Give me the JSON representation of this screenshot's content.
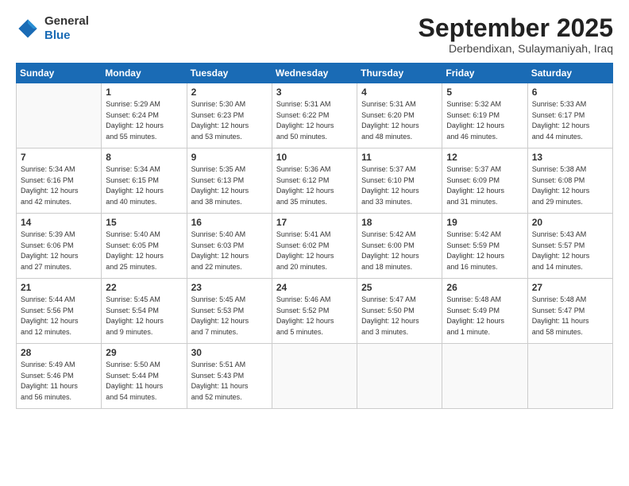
{
  "header": {
    "logo_line1": "General",
    "logo_line2": "Blue",
    "month": "September 2025",
    "location": "Derbendixan, Sulaymaniyah, Iraq"
  },
  "weekdays": [
    "Sunday",
    "Monday",
    "Tuesday",
    "Wednesday",
    "Thursday",
    "Friday",
    "Saturday"
  ],
  "weeks": [
    [
      {
        "num": "",
        "info": ""
      },
      {
        "num": "1",
        "info": "Sunrise: 5:29 AM\nSunset: 6:24 PM\nDaylight: 12 hours\nand 55 minutes."
      },
      {
        "num": "2",
        "info": "Sunrise: 5:30 AM\nSunset: 6:23 PM\nDaylight: 12 hours\nand 53 minutes."
      },
      {
        "num": "3",
        "info": "Sunrise: 5:31 AM\nSunset: 6:22 PM\nDaylight: 12 hours\nand 50 minutes."
      },
      {
        "num": "4",
        "info": "Sunrise: 5:31 AM\nSunset: 6:20 PM\nDaylight: 12 hours\nand 48 minutes."
      },
      {
        "num": "5",
        "info": "Sunrise: 5:32 AM\nSunset: 6:19 PM\nDaylight: 12 hours\nand 46 minutes."
      },
      {
        "num": "6",
        "info": "Sunrise: 5:33 AM\nSunset: 6:17 PM\nDaylight: 12 hours\nand 44 minutes."
      }
    ],
    [
      {
        "num": "7",
        "info": "Sunrise: 5:34 AM\nSunset: 6:16 PM\nDaylight: 12 hours\nand 42 minutes."
      },
      {
        "num": "8",
        "info": "Sunrise: 5:34 AM\nSunset: 6:15 PM\nDaylight: 12 hours\nand 40 minutes."
      },
      {
        "num": "9",
        "info": "Sunrise: 5:35 AM\nSunset: 6:13 PM\nDaylight: 12 hours\nand 38 minutes."
      },
      {
        "num": "10",
        "info": "Sunrise: 5:36 AM\nSunset: 6:12 PM\nDaylight: 12 hours\nand 35 minutes."
      },
      {
        "num": "11",
        "info": "Sunrise: 5:37 AM\nSunset: 6:10 PM\nDaylight: 12 hours\nand 33 minutes."
      },
      {
        "num": "12",
        "info": "Sunrise: 5:37 AM\nSunset: 6:09 PM\nDaylight: 12 hours\nand 31 minutes."
      },
      {
        "num": "13",
        "info": "Sunrise: 5:38 AM\nSunset: 6:08 PM\nDaylight: 12 hours\nand 29 minutes."
      }
    ],
    [
      {
        "num": "14",
        "info": "Sunrise: 5:39 AM\nSunset: 6:06 PM\nDaylight: 12 hours\nand 27 minutes."
      },
      {
        "num": "15",
        "info": "Sunrise: 5:40 AM\nSunset: 6:05 PM\nDaylight: 12 hours\nand 25 minutes."
      },
      {
        "num": "16",
        "info": "Sunrise: 5:40 AM\nSunset: 6:03 PM\nDaylight: 12 hours\nand 22 minutes."
      },
      {
        "num": "17",
        "info": "Sunrise: 5:41 AM\nSunset: 6:02 PM\nDaylight: 12 hours\nand 20 minutes."
      },
      {
        "num": "18",
        "info": "Sunrise: 5:42 AM\nSunset: 6:00 PM\nDaylight: 12 hours\nand 18 minutes."
      },
      {
        "num": "19",
        "info": "Sunrise: 5:42 AM\nSunset: 5:59 PM\nDaylight: 12 hours\nand 16 minutes."
      },
      {
        "num": "20",
        "info": "Sunrise: 5:43 AM\nSunset: 5:57 PM\nDaylight: 12 hours\nand 14 minutes."
      }
    ],
    [
      {
        "num": "21",
        "info": "Sunrise: 5:44 AM\nSunset: 5:56 PM\nDaylight: 12 hours\nand 12 minutes."
      },
      {
        "num": "22",
        "info": "Sunrise: 5:45 AM\nSunset: 5:54 PM\nDaylight: 12 hours\nand 9 minutes."
      },
      {
        "num": "23",
        "info": "Sunrise: 5:45 AM\nSunset: 5:53 PM\nDaylight: 12 hours\nand 7 minutes."
      },
      {
        "num": "24",
        "info": "Sunrise: 5:46 AM\nSunset: 5:52 PM\nDaylight: 12 hours\nand 5 minutes."
      },
      {
        "num": "25",
        "info": "Sunrise: 5:47 AM\nSunset: 5:50 PM\nDaylight: 12 hours\nand 3 minutes."
      },
      {
        "num": "26",
        "info": "Sunrise: 5:48 AM\nSunset: 5:49 PM\nDaylight: 12 hours\nand 1 minute."
      },
      {
        "num": "27",
        "info": "Sunrise: 5:48 AM\nSunset: 5:47 PM\nDaylight: 11 hours\nand 58 minutes."
      }
    ],
    [
      {
        "num": "28",
        "info": "Sunrise: 5:49 AM\nSunset: 5:46 PM\nDaylight: 11 hours\nand 56 minutes."
      },
      {
        "num": "29",
        "info": "Sunrise: 5:50 AM\nSunset: 5:44 PM\nDaylight: 11 hours\nand 54 minutes."
      },
      {
        "num": "30",
        "info": "Sunrise: 5:51 AM\nSunset: 5:43 PM\nDaylight: 11 hours\nand 52 minutes."
      },
      {
        "num": "",
        "info": ""
      },
      {
        "num": "",
        "info": ""
      },
      {
        "num": "",
        "info": ""
      },
      {
        "num": "",
        "info": ""
      }
    ]
  ]
}
